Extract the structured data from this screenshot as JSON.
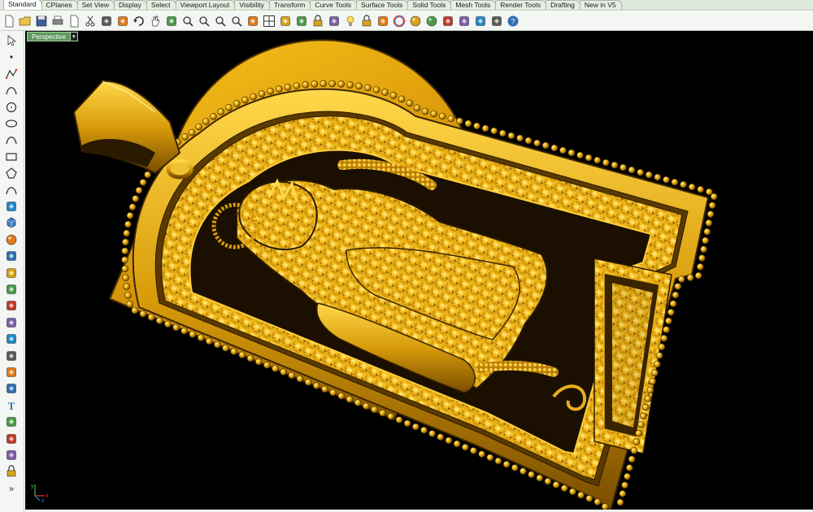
{
  "tabs": [
    "Standard",
    "CPlanes",
    "Set View",
    "Display",
    "Select",
    "Viewport Layout",
    "Visibility",
    "Transform",
    "Curve Tools",
    "Surface Tools",
    "Solid Tools",
    "Mesh Tools",
    "Render Tools",
    "Drafting",
    "New in V5"
  ],
  "active_tab": "Standard",
  "viewport": {
    "label": "Perspective",
    "menu_glyph": "▾",
    "axis_x": "x",
    "axis_y": "y",
    "axis_z": "z"
  },
  "toolbar_icons": [
    "new-icon",
    "open-icon",
    "save-icon",
    "print-icon",
    "import-icon",
    "cut-icon",
    "copy-icon",
    "paste-icon",
    "undo-icon",
    "pan-hand-icon",
    "move-icon",
    "zoom-icon",
    "zoom-window-icon",
    "zoom-extents-icon",
    "zoom-selected-icon",
    "rotate-view-icon",
    "four-viewports-icon",
    "hide-icon",
    "show-icon",
    "lock-icon",
    "layer-icon",
    "light-icon",
    "properties-lock-icon",
    "material-icon",
    "color-wheel-icon",
    "shaded-sphere-icon",
    "rendered-sphere-icon",
    "render-icon",
    "select-filter-icon",
    "settings-icon",
    "options-icon",
    "help-icon"
  ],
  "left_toolbar_icons": [
    "select-arrow-icon",
    "point-icon",
    "polyline-icon",
    "curve-icon",
    "circle-icon",
    "ellipse-icon",
    "arc-icon",
    "rectangle-icon",
    "polygon-icon",
    "fillet-icon",
    "surface-icon",
    "box-solid-icon",
    "sphere-solid-icon",
    "extrude-icon",
    "mesh-icon",
    "boolean-icon",
    "explode-icon",
    "trim-icon",
    "split-icon",
    "join-icon",
    "rotate-icon",
    "scale-icon",
    "text-icon",
    "dimension-icon",
    "array-icon",
    "analyze-icon",
    "block-icon",
    "more-icon"
  ],
  "left_toolbar_more": "»",
  "colors": {
    "viewport_bg": "#000000",
    "gold_base": "#c28a05",
    "gold_light": "#ffd23a",
    "gold_dark": "#6b4300",
    "viewport_tab": "#5e9a5c"
  }
}
